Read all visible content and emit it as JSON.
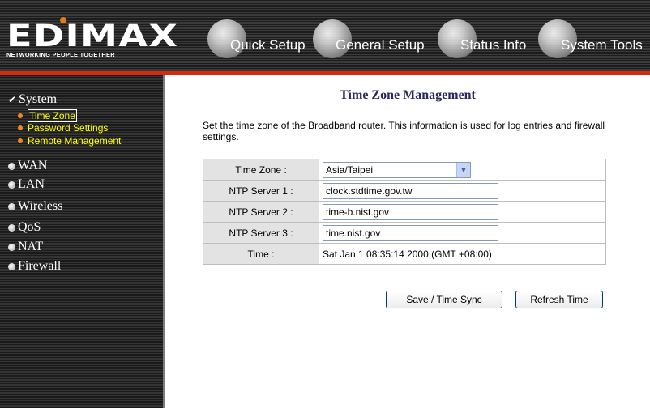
{
  "header": {
    "logo_text": "EDIMAX",
    "logo_tagline": "NETWORKING PEOPLE TOGETHER",
    "nav": {
      "quick_setup": "Quick Setup",
      "general_setup": "General Setup",
      "status_info": "Status Info",
      "system_tools": "System Tools"
    },
    "accent_color": "#d42a10"
  },
  "sidebar": {
    "system": "System",
    "system_items": {
      "time_zone": "Time Zone",
      "password_settings": "Password Settings",
      "remote_management": "Remote Management"
    },
    "wan": "WAN",
    "lan": "LAN",
    "wireless": "Wireless",
    "qos": "QoS",
    "nat": "NAT",
    "firewall": "Firewall"
  },
  "main": {
    "title": "Time Zone Management",
    "description": "Set the time zone of the Broadband router. This information is used for log entries and firewall settings.",
    "time_zone_label": "Time Zone :",
    "time_zone_value": "Asia/Taipei",
    "ntp1_label": "NTP Server 1 :",
    "ntp1_value": "clock.stdtime.gov.tw",
    "ntp2_label": "NTP Server 2 :",
    "ntp2_value": "time-b.nist.gov",
    "ntp3_label": "NTP Server 3 :",
    "ntp3_value": "time.nist.gov",
    "time_label": "Time :",
    "time_value": "Sat Jan 1 08:35:14 2000 (GMT +08:00)",
    "save_label": "Save / Time Sync",
    "refresh_label": "Refresh Time"
  }
}
